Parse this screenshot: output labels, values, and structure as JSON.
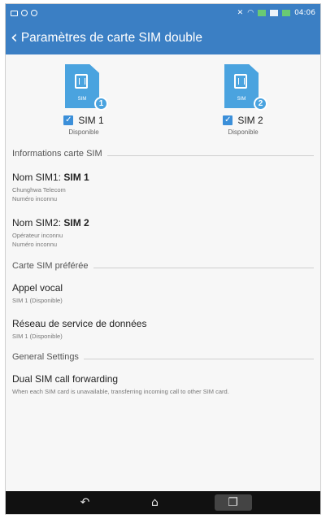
{
  "status_bar": {
    "time": "04:06"
  },
  "app_bar": {
    "title": "Paramètres de carte SIM double"
  },
  "sims": [
    {
      "card_label": "SIM",
      "number": "1",
      "name": "SIM 1",
      "status": "Disponible",
      "checked": true
    },
    {
      "card_label": "SIM",
      "number": "2",
      "name": "SIM 2",
      "status": "Disponible",
      "checked": true
    }
  ],
  "sections": {
    "sim_info": "Informations carte SIM",
    "preferred": "Carte SIM préférée",
    "general": "General Settings"
  },
  "sim1_info": {
    "label": "Nom SIM1: ",
    "value": "SIM 1",
    "operator": "Chunghwa Telecom",
    "number": "Numéro inconnu"
  },
  "sim2_info": {
    "label": "Nom SIM2: ",
    "value": "SIM 2",
    "operator": "Opérateur inconnu",
    "number": "Numéro inconnu"
  },
  "voice_call": {
    "title": "Appel vocal",
    "sub": "SIM 1 (Disponible)"
  },
  "data_network": {
    "title": "Réseau de service de données",
    "sub": "SIM 1 (Disponible)"
  },
  "forwarding": {
    "title": "Dual SIM call forwarding",
    "sub": "When each SIM card is unavailable, transferring incoming call to other SIM card."
  },
  "icons": {
    "back": "back-arrow-icon",
    "checkbox": "checkmark-icon",
    "nav_back": "back-icon",
    "nav_home": "home-icon",
    "nav_recent": "recent-apps-icon"
  },
  "colors": {
    "accent": "#3b7fc4",
    "sim_blue": "#4aa3df",
    "checkbox": "#3b8fd9",
    "nav_bar": "#111111"
  }
}
